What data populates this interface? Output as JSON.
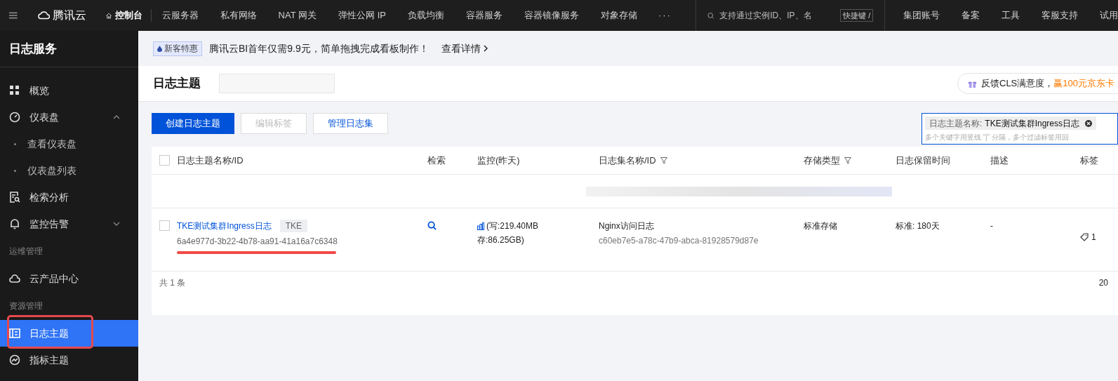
{
  "topbar": {
    "brand": "腾讯云",
    "console": "控制台",
    "nav": [
      "云服务器",
      "私有网络",
      "NAT 网关",
      "弹性公网 IP",
      "负载均衡",
      "容器服务",
      "容器镜像服务",
      "对象存储"
    ],
    "more": "···",
    "search": {
      "placeholder": "支持通过实例ID、IP、名"
    },
    "shortcut": "快捷键 /",
    "links": [
      "集团账号",
      "备案",
      "工具",
      "客服支持",
      "试用"
    ]
  },
  "sidebar": {
    "title": "日志服务",
    "items": [
      {
        "kind": "item",
        "label": "概览",
        "selected": false
      },
      {
        "kind": "item",
        "label": "仪表盘",
        "selected": false,
        "expanded": true,
        "children": [
          {
            "label": "查看仪表盘",
            "selected": false
          },
          {
            "label": "仪表盘列表",
            "selected": false
          }
        ]
      },
      {
        "kind": "item",
        "label": "检索分析",
        "selected": false
      },
      {
        "kind": "item",
        "label": "监控告警",
        "selected": false,
        "expanded": false
      },
      {
        "kind": "section",
        "label": "运维管理"
      },
      {
        "kind": "item",
        "label": "云产品中心",
        "selected": false
      },
      {
        "kind": "section",
        "label": "资源管理"
      },
      {
        "kind": "item",
        "label": "日志主题",
        "selected": true,
        "highlighted": true
      },
      {
        "kind": "item",
        "label": "指标主题",
        "selected": false
      }
    ]
  },
  "banner": {
    "badge": "新客特惠",
    "text": "腾讯云BI首年仅需9.9元，简单拖拽完成看板制作！",
    "link": "查看详情"
  },
  "header": {
    "title": "日志主题",
    "feedback": "反馈CLS满意度，",
    "feedback_highlight": "赢100元京东卡"
  },
  "toolbar": {
    "buttons": [
      {
        "label": "创建日志主题",
        "kind": "primary",
        "disabled": false
      },
      {
        "label": "编辑标签",
        "kind": "default",
        "disabled": true
      },
      {
        "label": "管理日志集",
        "kind": "default",
        "disabled": false
      }
    ],
    "filter": {
      "tag_key": "日志主题名称:",
      "tag_value": "TKE测试集群Ingress日志",
      "placeholder": "多个关键字用竖线 “|” 分隔，多个过滤标签用回"
    }
  },
  "table": {
    "all_checked": false,
    "columns": [
      {
        "label": "日志主题名称/ID",
        "filter": false
      },
      {
        "label": "检索",
        "filter": false
      },
      {
        "label": "监控(昨天)",
        "filter": false
      },
      {
        "label": "日志集名称/ID",
        "filter": true
      },
      {
        "label": "存储类型",
        "filter": true
      },
      {
        "label": "日志保留时间",
        "filter": false
      },
      {
        "label": "描述",
        "filter": false
      },
      {
        "label": "标签",
        "filter": false
      }
    ],
    "rows": [
      {
        "checked": false,
        "name": "TKE测试集群Ingress日志",
        "tag": "TKE",
        "id": "6a4e977d-3b22-4b78-aa91-41a16a7c6348",
        "id_underlined": true,
        "monitor_write": "(写:219.40MB",
        "monitor_store": "存:86.25GB)",
        "logset_name": "Nginx访问日志",
        "logset_id": "c60eb7e5-a78c-47b9-abca-81928579d87e",
        "storage": "标准存储",
        "retention": "标准: 180天",
        "description": "-",
        "tags": "1"
      }
    ],
    "total": "共 1 条",
    "page_size": "20"
  }
}
